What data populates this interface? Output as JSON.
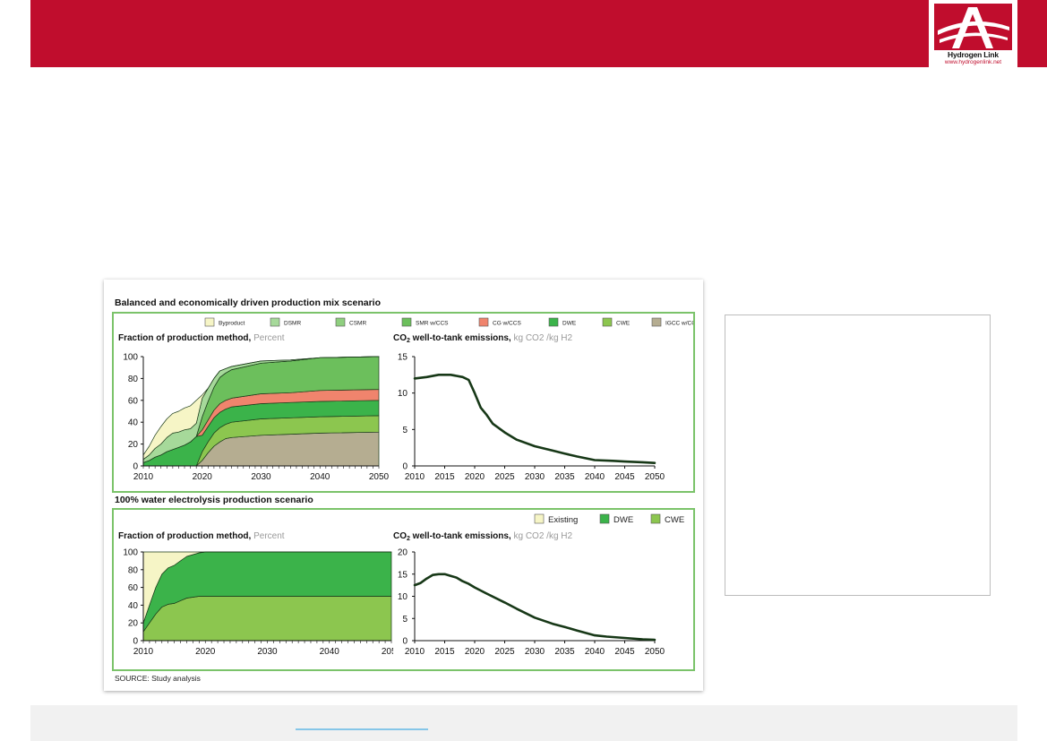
{
  "brand": {
    "logo_name": "Hydrogen Link",
    "logo_url": "www.hydrogenlink.net"
  },
  "figure": {
    "source": "SOURCE: Study analysis",
    "scenarios": [
      {
        "title": "Balanced and economically driven production mix scenario",
        "legend": [
          {
            "label": "Byproduct",
            "color": "#f6f5c6"
          },
          {
            "label": "DSMR",
            "color": "#a6d99a"
          },
          {
            "label": "CSMR",
            "color": "#8fcf7f"
          },
          {
            "label": "SMR w/CCS",
            "color": "#6cbf5c"
          },
          {
            "label": "CG w/CCS",
            "color": "#f0846d"
          },
          {
            "label": "DWE",
            "color": "#3bb34a"
          },
          {
            "label": "CWE",
            "color": "#8cc64f"
          },
          {
            "label": "IGCC w/CCS",
            "color": "#b5ad91"
          }
        ]
      },
      {
        "title": "100% water electrolysis production scenario",
        "legend": [
          {
            "label": "Existing",
            "color": "#f6f5c6"
          },
          {
            "label": "DWE",
            "color": "#3bb34a"
          },
          {
            "label": "CWE",
            "color": "#8cc64f"
          }
        ]
      }
    ]
  },
  "chart_data": [
    {
      "type": "area",
      "title": "Fraction of production method,",
      "unit": "Percent",
      "x": [
        2010,
        2011,
        2012,
        2013,
        2014,
        2015,
        2016,
        2017,
        2018,
        2019,
        2020,
        2021,
        2022,
        2023,
        2024,
        2025,
        2030,
        2035,
        2040,
        2050
      ],
      "ylim": [
        0,
        100
      ],
      "xlim": [
        2010,
        2050
      ],
      "xticks": [
        2010,
        2020,
        2030,
        2040,
        2050
      ],
      "yticks": [
        0,
        20,
        40,
        60,
        80,
        100
      ],
      "stack_order": "top-to-bottom",
      "series": [
        {
          "name": "Byproduct",
          "values": [
            4,
            8,
            12,
            16,
            17,
            18,
            19,
            20,
            21,
            21,
            3,
            0,
            0,
            0,
            0,
            0,
            0,
            0,
            0,
            0
          ]
        },
        {
          "name": "DSMR",
          "values": [
            3,
            5,
            8,
            10,
            13,
            15,
            14,
            14,
            12,
            12,
            17,
            12,
            8,
            6,
            4,
            3,
            2,
            1,
            0,
            0
          ]
        },
        {
          "name": "CSMR",
          "values": [
            0,
            0,
            0,
            0,
            0,
            0,
            0,
            0,
            0,
            0,
            0,
            0,
            0,
            0,
            0,
            0,
            0,
            0,
            0,
            0
          ]
        },
        {
          "name": "SMR w/CCS",
          "values": [
            0,
            0,
            0,
            0,
            0,
            0,
            0,
            0,
            0,
            0,
            12,
            17,
            21,
            24,
            25,
            26,
            28,
            29,
            30,
            30
          ]
        },
        {
          "name": "CG w/CCS",
          "values": [
            0,
            0,
            0,
            0,
            0,
            0,
            0,
            0,
            0,
            0,
            5,
            6,
            7,
            8,
            8,
            8,
            9,
            9,
            10,
            10
          ]
        },
        {
          "name": "DWE",
          "values": [
            3,
            5,
            8,
            10,
            13,
            15,
            17,
            19,
            22,
            27,
            15,
            14,
            14,
            14,
            14,
            14,
            14,
            14,
            14,
            14
          ]
        },
        {
          "name": "CWE",
          "values": [
            0,
            0,
            0,
            0,
            0,
            0,
            0,
            0,
            0,
            0,
            8,
            10,
            12,
            13,
            13,
            14,
            15,
            15,
            15,
            15
          ]
        },
        {
          "name": "IGCC w/CCS",
          "values": [
            0,
            0,
            0,
            0,
            0,
            0,
            0,
            0,
            0,
            0,
            5,
            12,
            18,
            22,
            25,
            26,
            28,
            29,
            30,
            31
          ]
        }
      ]
    },
    {
      "type": "line",
      "title_prefix": "CO",
      "title_sub": "2",
      "title_suffix": " well-to-tank emissions,",
      "unit": "kg CO2 /kg H2",
      "x": [
        2010,
        2012,
        2014,
        2016,
        2018,
        2019,
        2020,
        2021,
        2022,
        2023,
        2025,
        2027,
        2030,
        2033,
        2035,
        2037,
        2040,
        2043,
        2045,
        2048,
        2050
      ],
      "y": [
        12,
        12.2,
        12.5,
        12.5,
        12.2,
        11.8,
        10,
        8,
        7,
        5.8,
        4.6,
        3.6,
        2.7,
        2.1,
        1.7,
        1.3,
        0.8,
        0.7,
        0.6,
        0.5,
        0.4
      ],
      "ylim": [
        0,
        15
      ],
      "xlim": [
        2010,
        2050
      ],
      "xticks": [
        2010,
        2015,
        2020,
        2025,
        2030,
        2035,
        2040,
        2045,
        2050
      ],
      "yticks": [
        0,
        5,
        10,
        15
      ]
    },
    {
      "type": "area",
      "title": "Fraction of production method,",
      "unit": "Percent",
      "x": [
        2010,
        2011,
        2012,
        2013,
        2014,
        2015,
        2016,
        2017,
        2018,
        2019,
        2020,
        2025,
        2030,
        2040,
        2050
      ],
      "ylim": [
        0,
        100
      ],
      "xlim": [
        2010,
        2050
      ],
      "xticks": [
        2010,
        2020,
        2030,
        2040,
        2050
      ],
      "yticks": [
        0,
        20,
        40,
        60,
        80,
        100
      ],
      "stack_order": "top-to-bottom",
      "series": [
        {
          "name": "Existing",
          "values": [
            80,
            60,
            40,
            25,
            18,
            15,
            10,
            5,
            3,
            1,
            0,
            0,
            0,
            0,
            0
          ]
        },
        {
          "name": "DWE",
          "values": [
            10,
            20,
            30,
            37,
            41,
            43,
            45,
            47,
            48,
            49,
            50,
            50,
            50,
            50,
            50
          ]
        },
        {
          "name": "CWE",
          "values": [
            10,
            20,
            30,
            38,
            41,
            42,
            45,
            48,
            49,
            50,
            50,
            50,
            50,
            50,
            50
          ]
        }
      ]
    },
    {
      "type": "line",
      "title_prefix": "CO",
      "title_sub": "2",
      "title_suffix": " well-to-tank emissions,",
      "unit": "kg CO2 /kg H2",
      "x": [
        2010,
        2011,
        2012,
        2013,
        2014,
        2015,
        2016,
        2017,
        2018,
        2019,
        2020,
        2022,
        2025,
        2027,
        2030,
        2033,
        2035,
        2037,
        2040,
        2042,
        2045,
        2048,
        2050
      ],
      "y": [
        12.5,
        13,
        14,
        14.8,
        15,
        15,
        14.6,
        14.2,
        13.4,
        12.8,
        12,
        10.6,
        8.6,
        7.2,
        5.2,
        3.8,
        3.1,
        2.3,
        1.2,
        0.9,
        0.6,
        0.3,
        0.2
      ],
      "ylim": [
        0,
        20
      ],
      "xlim": [
        2010,
        2050
      ],
      "xticks": [
        2010,
        2015,
        2020,
        2025,
        2030,
        2035,
        2040,
        2045,
        2050
      ],
      "yticks": [
        0,
        5,
        10,
        15,
        20
      ]
    }
  ]
}
